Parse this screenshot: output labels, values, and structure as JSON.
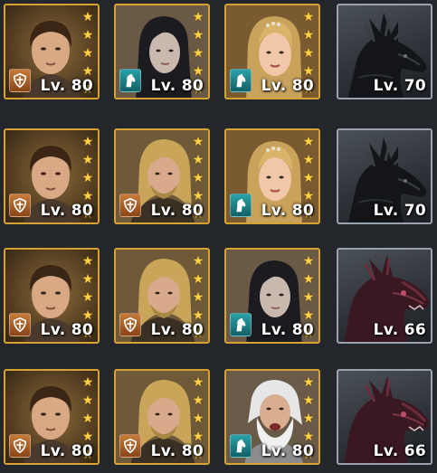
{
  "grid": {
    "rows": [
      {
        "cards": [
          {
            "kind": "hero",
            "character": "dark-haired-man",
            "stars": 5,
            "class_icon": "warrior-shield-icon",
            "level": "Lv. 80"
          },
          {
            "kind": "hero",
            "character": "dark-haired-woman",
            "stars": 5,
            "class_icon": "cavalry-horse-icon",
            "level": "Lv. 80"
          },
          {
            "kind": "hero",
            "character": "blonde-woman",
            "stars": 5,
            "class_icon": "cavalry-horse-icon",
            "level": "Lv. 80"
          },
          {
            "kind": "dragon",
            "character": "black-dragon",
            "level": "Lv. 70"
          }
        ]
      },
      {
        "cards": [
          {
            "kind": "hero",
            "character": "dark-haired-man",
            "stars": 5,
            "class_icon": "warrior-shield-icon",
            "level": "Lv. 80"
          },
          {
            "kind": "hero",
            "character": "blond-bearded-man",
            "stars": 5,
            "class_icon": "warrior-shield-icon",
            "level": "Lv. 80"
          },
          {
            "kind": "hero",
            "character": "blonde-woman",
            "stars": 5,
            "class_icon": "cavalry-horse-icon",
            "level": "Lv. 80"
          },
          {
            "kind": "dragon",
            "character": "black-dragon",
            "level": "Lv. 70"
          }
        ]
      },
      {
        "cards": [
          {
            "kind": "hero",
            "character": "dark-haired-man",
            "stars": 5,
            "class_icon": "warrior-shield-icon",
            "level": "Lv. 80"
          },
          {
            "kind": "hero",
            "character": "blond-bearded-man",
            "stars": 5,
            "class_icon": "warrior-shield-icon",
            "level": "Lv. 80"
          },
          {
            "kind": "hero",
            "character": "dark-haired-woman",
            "stars": 5,
            "class_icon": "cavalry-horse-icon",
            "level": "Lv. 80"
          },
          {
            "kind": "dragon",
            "character": "red-dragon",
            "level": "Lv. 66"
          }
        ]
      },
      {
        "cards": [
          {
            "kind": "hero",
            "character": "dark-haired-man",
            "stars": 5,
            "class_icon": "warrior-shield-icon",
            "level": "Lv. 80"
          },
          {
            "kind": "hero",
            "character": "blond-bearded-man",
            "stars": 5,
            "class_icon": "warrior-shield-icon",
            "level": "Lv. 80"
          },
          {
            "kind": "hero",
            "character": "white-bearded-old-man",
            "stars": 5,
            "class_icon": "cavalry-horse-icon",
            "level": "Lv. 80"
          },
          {
            "kind": "dragon",
            "character": "red-dragon",
            "level": "Lv. 66"
          }
        ]
      }
    ]
  },
  "colors": {
    "background": "#23262b",
    "hero_frame": "#d6a234",
    "dragon_frame": "#9aa3ad",
    "star": "#ffd04a",
    "warrior_badge": "#c77b3a",
    "cavalry_badge": "#2aa2a8"
  }
}
